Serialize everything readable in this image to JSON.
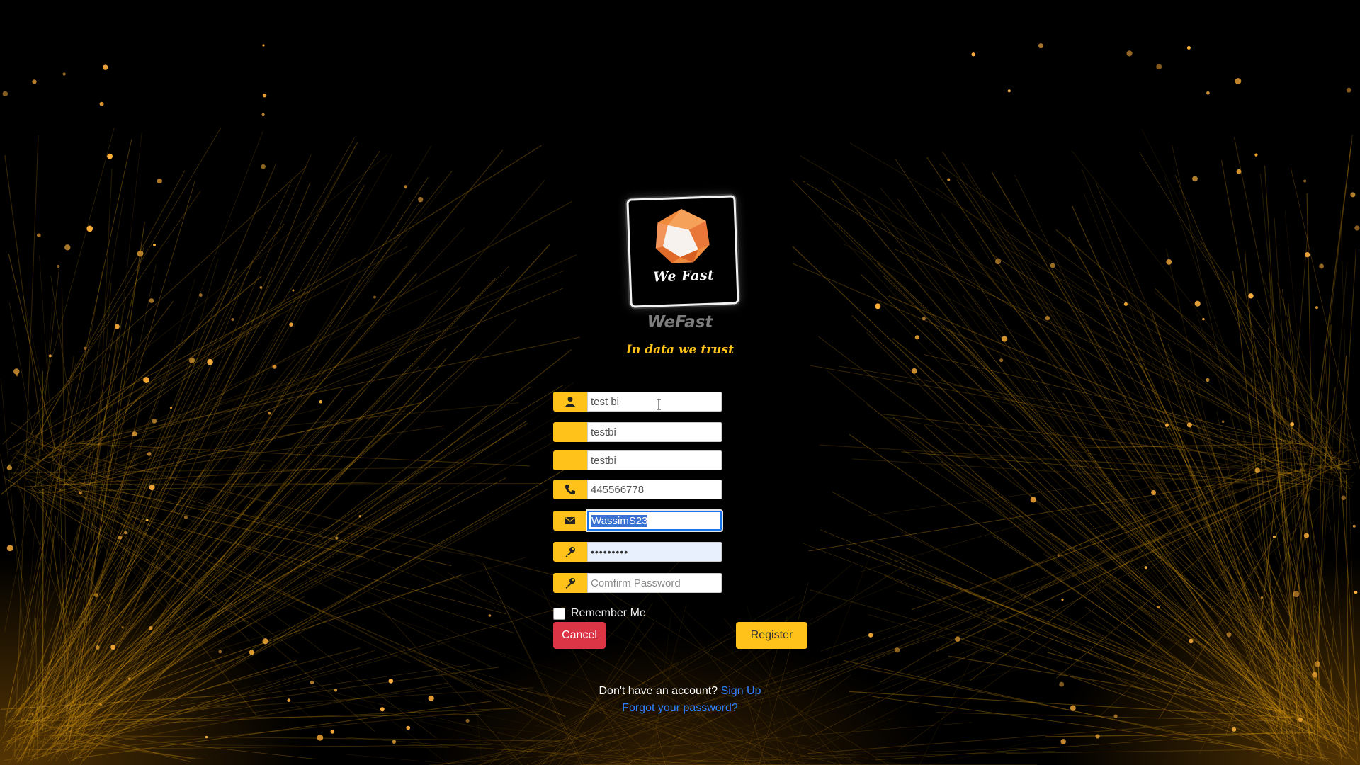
{
  "brand": {
    "logo_text": "We Fast",
    "title": "WeFast",
    "tagline": "In data we trust"
  },
  "form": {
    "fields": [
      {
        "icon": "user-icon",
        "value": "test bi",
        "placeholder": ""
      },
      {
        "icon": "",
        "value": "testbi",
        "placeholder": ""
      },
      {
        "icon": "",
        "value": "testbi",
        "placeholder": ""
      },
      {
        "icon": "phone-icon",
        "value": "445566778",
        "placeholder": ""
      },
      {
        "icon": "envelope-icon",
        "value": "WassimS23",
        "placeholder": "",
        "selected": true
      },
      {
        "icon": "key-icon",
        "value": "•••••••••",
        "placeholder": "",
        "autofill": true
      },
      {
        "icon": "key-icon",
        "value": "",
        "placeholder": "Comfirm Password"
      }
    ],
    "remember_label": "Remember Me",
    "remember_checked": false,
    "cancel_label": "Cancel",
    "register_label": "Register"
  },
  "footer": {
    "signup_prompt": "Don't have an account?",
    "signup_link": "Sign Up",
    "forgot_link": "Forgot your password?"
  },
  "colors": {
    "accent": "#ffc21a",
    "cancel": "#dc3545",
    "link": "#2f80ff",
    "background": "#000000"
  }
}
